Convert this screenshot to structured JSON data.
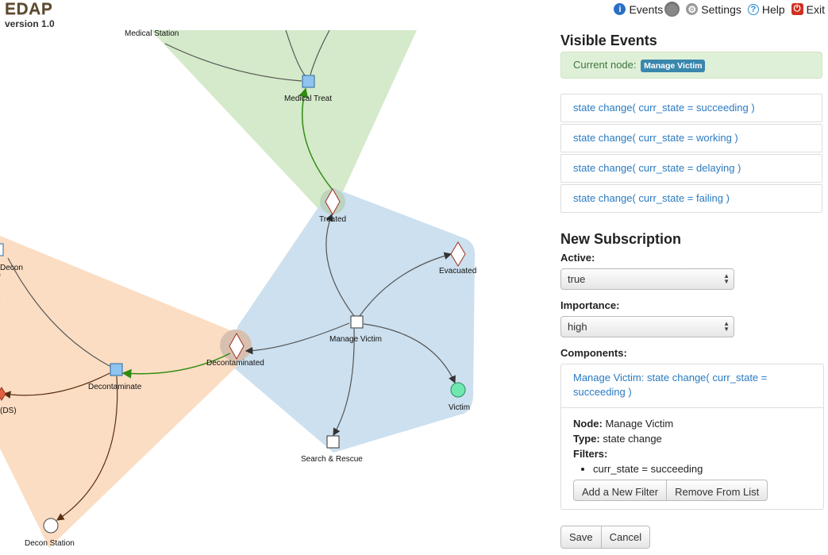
{
  "app": {
    "title": "EDAP",
    "version": "version 1.0"
  },
  "nav": {
    "events": "Events",
    "settings": "Settings",
    "help": "Help",
    "exit": "Exit"
  },
  "graph": {
    "labels": {
      "medical_station": "Medical Station",
      "medical_treat": "Medical Treat",
      "treated": "Treated",
      "decon": "Decon",
      "evacuated": "Evacuated",
      "manage_victim": "Manage Victim",
      "decontaminated": "Decontaminated",
      "decontaminate": "Decontaminate",
      "ds": "(DS)",
      "victim": "Victim",
      "search_rescue": "Search & Rescue",
      "decon_station": "Decon Station"
    },
    "colors": {
      "green_region": "#cfe8c4",
      "blue_region": "#c9deee",
      "orange_region": "#fbd9bc"
    }
  },
  "visible_events": {
    "heading": "Visible Events",
    "current_node_label": "Current node:",
    "current_node": "Manage Victim",
    "events": [
      "state change( curr_state = succeeding )",
      "state change( curr_state = working )",
      "state change( curr_state = delaying )",
      "state change( curr_state = failing )"
    ]
  },
  "subscription": {
    "heading": "New Subscription",
    "active_label": "Active:",
    "active_value": "true",
    "importance_label": "Importance:",
    "importance_value": "high",
    "components_label": "Components:",
    "component": {
      "title": "Manage Victim: state change( curr_state = succeeding )",
      "node_label": "Node:",
      "node_value": "Manage Victim",
      "type_label": "Type:",
      "type_value": "state change",
      "filters_label": "Filters:",
      "filters": [
        "curr_state = succeeding"
      ],
      "add_filter": "Add a New Filter",
      "remove": "Remove From List"
    },
    "save": "Save",
    "cancel": "Cancel"
  }
}
